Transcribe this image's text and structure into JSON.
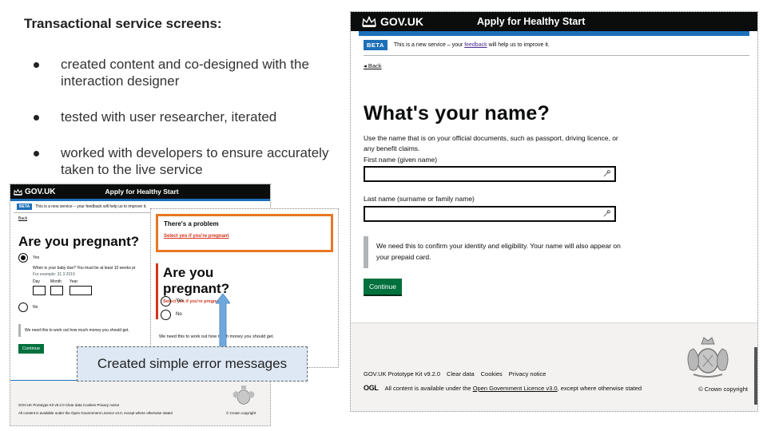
{
  "slide": {
    "heading": "Transactional service screens:",
    "bullets": [
      "created content and co-designed with the interaction designer",
      "tested with user researcher, iterated",
      "worked with developers to ensure accurately taken to the live service"
    ],
    "callout": "Created simple error messages"
  },
  "thumb_background": {
    "logo": "GOV.UK",
    "service": "Apply for Healthy Start",
    "beta_tag": "BETA",
    "beta_text": "This is a new service – your feedback will help us to improve it.",
    "back": "Back",
    "title": "Are you pregnant?",
    "yes": "Yes",
    "due_hint": "When is your baby due? You must be at least 10 weeks pr",
    "example": "For example: 31 3 2019",
    "day": "Day",
    "month": "Month",
    "year": "Year",
    "no": "No",
    "inset": "We need this to work out how much money you should get.",
    "continue": "Continue",
    "footer_links": "GOV.UK Prototype Kit v9.2.0   Clear data   Cookies   Privacy notice",
    "licence": "All content is available under the Open Government Licence v3.0, except where otherwise stated",
    "copyright": "© Crown copyright"
  },
  "thumb_error": {
    "summary_title": "There's a problem",
    "summary_link": "Select yes if you're pregnant",
    "title": "Are you pregnant?",
    "error_message": "Select yes if you're pregnant",
    "yes": "Yes",
    "no": "No",
    "inset": "We need this to work out how much money you should get."
  },
  "main": {
    "logo": "GOV.UK",
    "service": "Apply for Healthy Start",
    "beta_tag": "BETA",
    "beta_text_before": "This is a new service – your ",
    "beta_link": "feedback",
    "beta_text_after": " will help us to improve it.",
    "back": "Back",
    "title": "What's your name?",
    "hint": "Use the name that is on your official documents, such as passport, driving licence, or any benefit claims.",
    "first_name_label": "First name (given name)",
    "last_name_label": "Last name (surname or family name)",
    "inset": "We need this to confirm your identity and eligibility. Your name will also appear on your prepaid card.",
    "continue": "Continue",
    "footer_links": [
      "GOV.UK Prototype Kit v9.2.0",
      "Clear data",
      "Cookies",
      "Privacy notice"
    ],
    "ogl": "OGL",
    "licence_before": "All content is available under the ",
    "licence_link": "Open Government Licence v3.0",
    "licence_after": ", except where otherwise stated",
    "copyright": "© Crown copyright"
  },
  "colors": {
    "govuk_black": "#0b0c0c",
    "govuk_blue": "#1d70b8",
    "govuk_green": "#00703c",
    "error_red": "#d4351c",
    "error_border": "#e87722",
    "callout_bg": "#dde8f4"
  }
}
